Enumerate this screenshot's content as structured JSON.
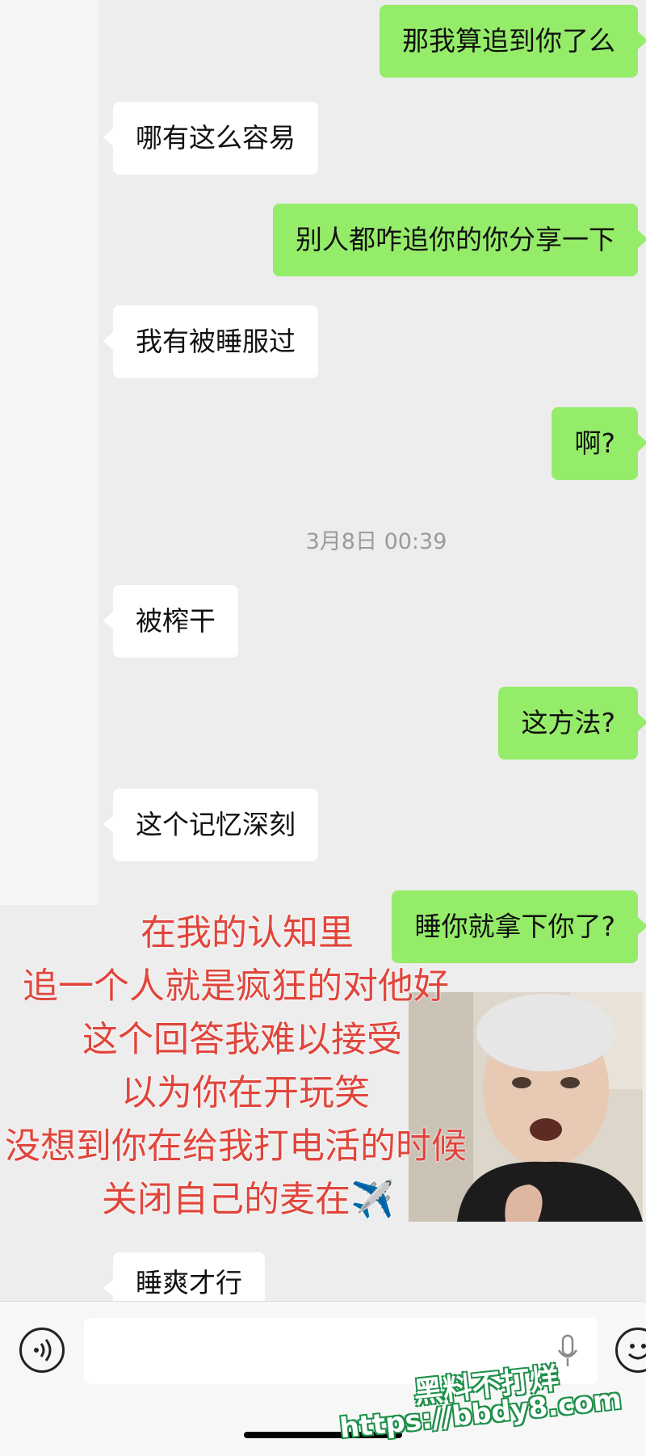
{
  "messages": [
    {
      "side": "out",
      "text": "那我算追到你了么"
    },
    {
      "side": "in",
      "text": "哪有这么容易"
    },
    {
      "side": "out",
      "text": "别人都咋追你的你分享一下"
    },
    {
      "side": "in",
      "text": "我有被睡服过"
    },
    {
      "side": "out",
      "text": "啊?"
    },
    {
      "side": "in",
      "text": "被榨干"
    },
    {
      "side": "out",
      "text": "这方法?"
    },
    {
      "side": "in",
      "text": "这个记忆深刻"
    },
    {
      "side": "out",
      "text": "睡你就拿下你了?"
    },
    {
      "side": "in",
      "text": "睡爽才行"
    }
  ],
  "timestamp": "3月8日 00:39",
  "overlay": {
    "lines": [
      "在我的认知里",
      "追一个人就是疯狂的对他好",
      "这个回答我难以接受",
      "以为你在开玩笑",
      "没想到你在给我打电活的时候",
      "关闭自己的麦在✈️"
    ],
    "color": "#e0463c"
  },
  "watermark": {
    "line1": "黑料不打烊",
    "line2": "https://bbdy8.com"
  },
  "colors": {
    "background": "#ededed",
    "incoming_bubble": "#ffffff",
    "outgoing_bubble": "#95ec69"
  },
  "icons": [
    "voice-input-icon",
    "microphone-icon",
    "emoji-icon",
    "airplane-emoji"
  ]
}
